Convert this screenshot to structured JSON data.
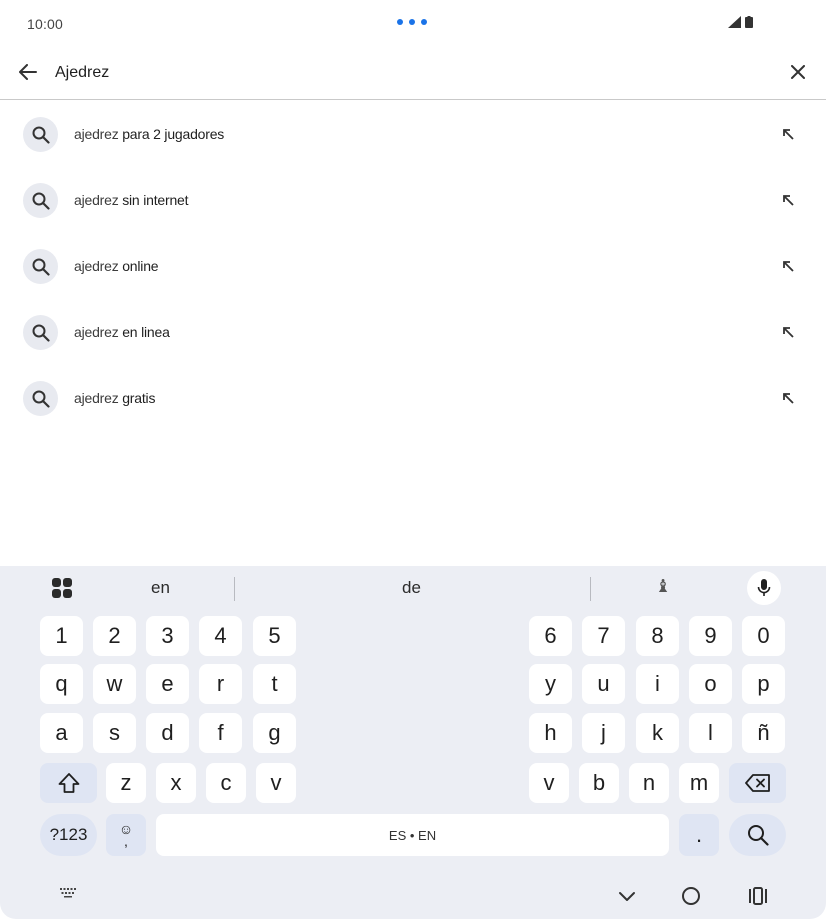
{
  "status_bar": {
    "time": "10:00"
  },
  "search": {
    "query": "Ajedrez"
  },
  "suggestions": [
    {
      "typed": "ajedrez",
      "rest": " para 2 jugadores"
    },
    {
      "typed": "ajedrez",
      "rest": " sin internet"
    },
    {
      "typed": "ajedrez",
      "rest": " online"
    },
    {
      "typed": "ajedrez",
      "rest": " en linea"
    },
    {
      "typed": "ajedrez",
      "rest": " gratis"
    }
  ],
  "keyboard": {
    "suggestions": [
      "en",
      "de"
    ],
    "emoji_suggestion": "♝",
    "number_row": [
      "1",
      "2",
      "3",
      "4",
      "5",
      "6",
      "7",
      "8",
      "9",
      "0"
    ],
    "row1": [
      "q",
      "w",
      "e",
      "r",
      "t",
      "y",
      "u",
      "i",
      "o",
      "p"
    ],
    "row2": [
      "a",
      "s",
      "d",
      "f",
      "g",
      "h",
      "j",
      "k",
      "l",
      "ñ"
    ],
    "row3": [
      "z",
      "x",
      "c",
      "v",
      "v",
      "b",
      "n",
      "m"
    ],
    "symbols_key": "?123",
    "emoji_key_top": "☺",
    "emoji_key_bottom": ",",
    "space_label": "ES • EN",
    "period_key": "."
  },
  "colors": {
    "accent": "#1a73e8",
    "keyboard_bg": "#eceef4",
    "key_bg": "#ffffff",
    "key_dark_bg": "#dfe5f3"
  }
}
